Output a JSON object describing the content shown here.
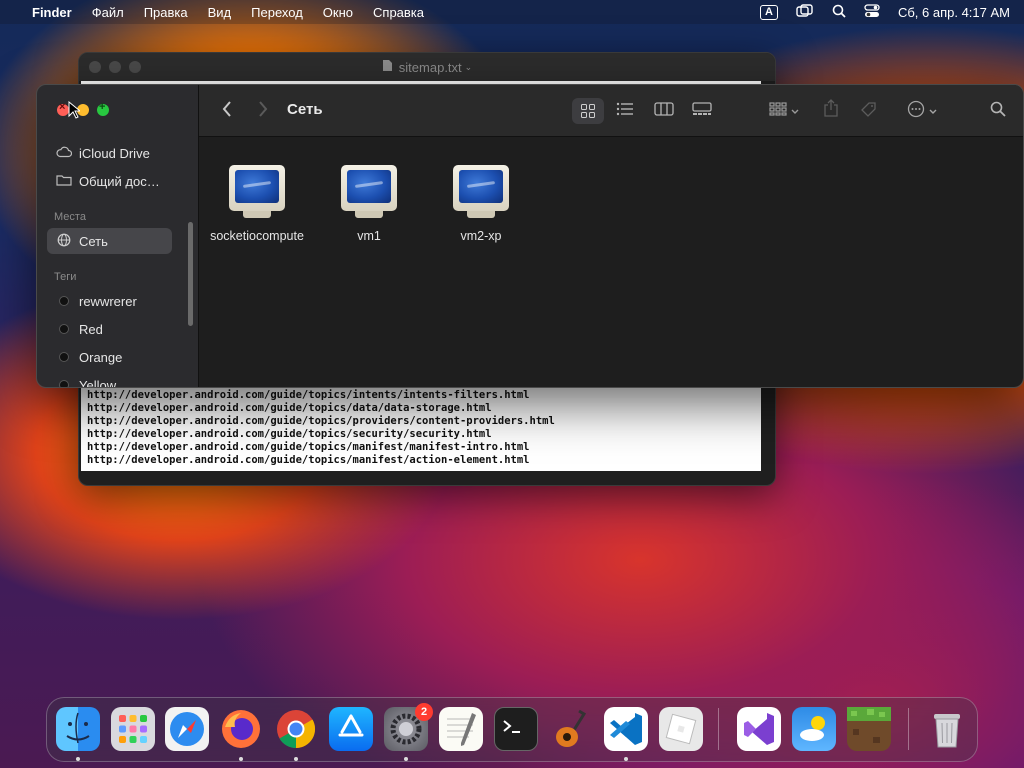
{
  "menubar": {
    "app": "Finder",
    "items": [
      "Файл",
      "Правка",
      "Вид",
      "Переход",
      "Окно",
      "Справка"
    ],
    "input_indicator": "A",
    "clock": "Сб, 6 апр.  4:17 AM"
  },
  "editor": {
    "title": "sitemap.txt",
    "lines": [
      "http://developer.android.com/guide/topics/intents/intents-filters.html",
      "http://developer.android.com/guide/topics/data/data-storage.html",
      "http://developer.android.com/guide/topics/providers/content-providers.html",
      "http://developer.android.com/guide/topics/security/security.html",
      "http://developer.android.com/guide/topics/manifest/manifest-intro.html",
      "http://developer.android.com/guide/topics/manifest/action-element.html"
    ]
  },
  "finder": {
    "title": "Сеть",
    "sidebar": {
      "items": [
        {
          "label": "iCloud Drive",
          "icon": "cloud-icon"
        },
        {
          "label": "Общий дос…",
          "icon": "shared-folder-icon"
        }
      ],
      "places_header": "Места",
      "places": [
        {
          "label": "Сеть",
          "icon": "network-globe-icon",
          "selected": true
        }
      ],
      "tags_header": "Теги",
      "tags": [
        {
          "label": "rewwrerer",
          "color": "#111111"
        },
        {
          "label": "Red",
          "color": "#111111"
        },
        {
          "label": "Orange",
          "color": "#111111"
        },
        {
          "label": "Yellow",
          "color": "#111111"
        }
      ]
    },
    "items": [
      {
        "label": "socketiocompute",
        "icon": "network-computer-icon"
      },
      {
        "label": "vm1",
        "icon": "network-computer-icon"
      },
      {
        "label": "vm2-xp",
        "icon": "network-computer-icon"
      }
    ]
  },
  "dock": {
    "apps": [
      "Finder",
      "Launchpad",
      "Safari",
      "Firefox",
      "Chrome",
      "App Store",
      "System Settings",
      "TextEdit",
      "Terminal",
      "GarageBand",
      "VS Code",
      "Roblox",
      "Visual Studio",
      "Weather",
      "Minecraft",
      "Trash"
    ],
    "settings_badge": "2"
  }
}
